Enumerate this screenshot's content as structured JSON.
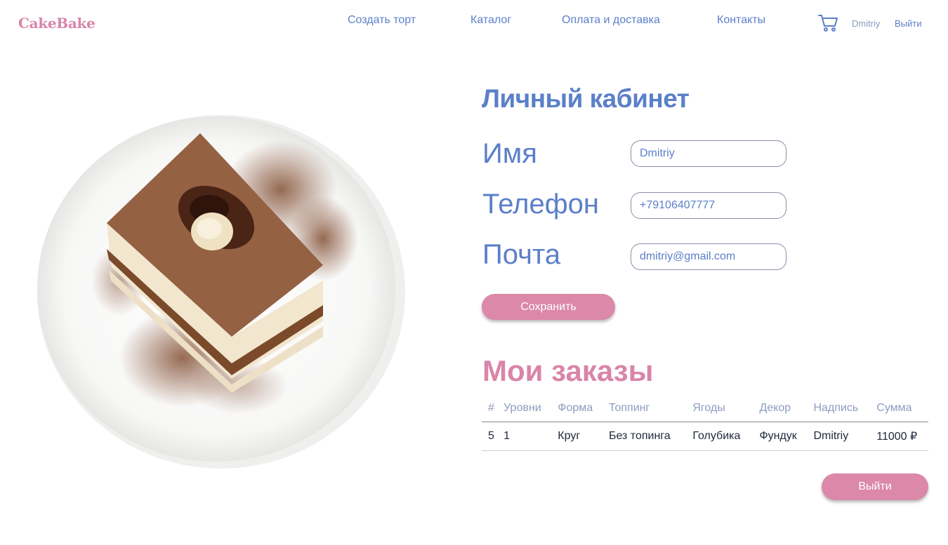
{
  "header": {
    "logo": "CakeBake",
    "nav": [
      "Создать торт",
      "Каталог",
      "Оплата и доставка",
      "Контакты"
    ],
    "cart_icon": "cart-icon",
    "user_name": "Dmitriy",
    "logout_label": "Выйти"
  },
  "profile": {
    "title": "Личный кабинет",
    "fields": [
      {
        "label": "Имя",
        "value": "Dmitriy"
      },
      {
        "label": "Телефон",
        "value": "+79106407777"
      },
      {
        "label": "Почта",
        "value": "dmitriy@gmail.com"
      }
    ],
    "save_label": "Сохранить"
  },
  "orders": {
    "title": "Мои заказы",
    "columns": [
      "#",
      "Уровни",
      "Форма",
      "Топпинг",
      "Ягоды",
      "Декор",
      "Надпись",
      "Сумма"
    ],
    "rows": [
      [
        "5",
        "1",
        "Круг",
        "Без топинга",
        "Голубика",
        "Фундук",
        "Dmitriy",
        "11000 ₽"
      ]
    ]
  },
  "exit_label": "Выйти",
  "colors": {
    "primary_blue": "#5b7fc9",
    "accent_pink": "#db88a9",
    "muted": "#8e9cc0"
  }
}
